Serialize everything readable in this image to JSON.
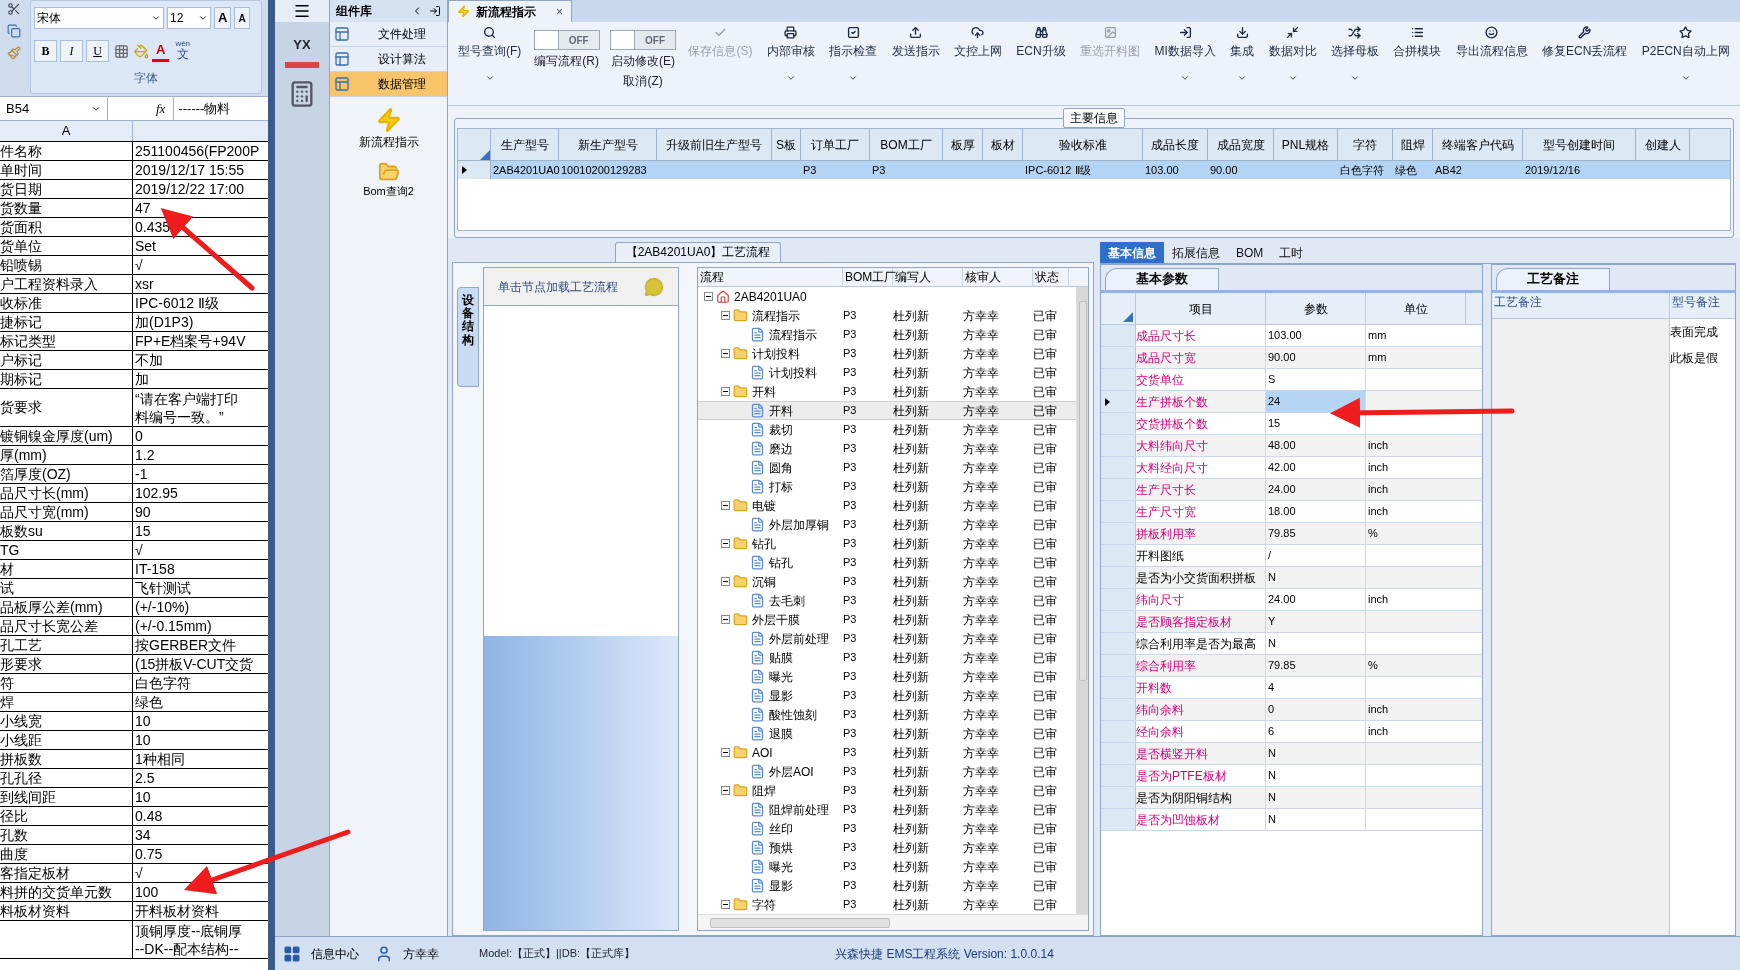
{
  "excel": {
    "font": "宋体",
    "size": "12",
    "grow": "A",
    "shrink": "A",
    "format_buttons": [
      "B",
      "I",
      "U"
    ],
    "font_color": "A",
    "phonetic_top": "wén",
    "phonetic": "文",
    "group_label": "字体",
    "name_box": "B54",
    "fx": "fx",
    "formula": "------物料",
    "column": "A",
    "rows": [
      {
        "label": "件名称",
        "value": "251100456(FP200P"
      },
      {
        "label": "单时间",
        "value": "2019/12/17 15:55"
      },
      {
        "label": "货日期",
        "value": "2019/12/22 17:00"
      },
      {
        "label": "货数量",
        "value": "47"
      },
      {
        "label": "货面积",
        "value": "0.435"
      },
      {
        "label": "货单位",
        "value": "Set"
      },
      {
        "label": "铅喷锡",
        "value": "√"
      },
      {
        "label": "户工程资料录入",
        "value": "xsr"
      },
      {
        "label": "收标准",
        "value": "IPC-6012 Ⅱ级"
      },
      {
        "label": "捷标记",
        "value": "加(D1P3)"
      },
      {
        "label": "标记类型",
        "value": "FP+E档案号+94V"
      },
      {
        "label": "户标记",
        "value": "不加"
      },
      {
        "label": "期标记",
        "value": "加"
      },
      {
        "label": "货要求",
        "value": "“请在客户端打印",
        "value2": "料编号一致。”"
      },
      {
        "label": "镀铜镍金厚度(um)",
        "value": "0"
      },
      {
        "label": "厚(mm)",
        "value": "1.2"
      },
      {
        "label": "箔厚度(OZ)",
        "value": "-1"
      },
      {
        "label": "品尺寸长(mm)",
        "value": "102.95"
      },
      {
        "label": "品尺寸宽(mm)",
        "value": "90"
      },
      {
        "label": "板数su",
        "value": "15"
      },
      {
        "label": "TG",
        "value": "√"
      },
      {
        "label": "材",
        "value": "IT-158"
      },
      {
        "label": "试",
        "value": "飞针测试"
      },
      {
        "label": "品板厚公差(mm)",
        "value": "(+/-10%)"
      },
      {
        "label": "品尺寸长宽公差",
        "value": "(+/-0.15mm)"
      },
      {
        "label": "孔工艺",
        "value": "按GERBER文件"
      },
      {
        "label": "形要求",
        "value": "(15拼板V-CUT交货"
      },
      {
        "label": "符",
        "value": "白色字符"
      },
      {
        "label": "焊",
        "value": "绿色"
      },
      {
        "label": "小线宽",
        "value": "10"
      },
      {
        "label": "小线距",
        "value": "10"
      },
      {
        "label": "拼板数",
        "value": "1种相同"
      },
      {
        "label": "孔孔径",
        "value": "2.5"
      },
      {
        "label": "到线间距",
        "value": "10"
      },
      {
        "label": "径比",
        "value": "0.48"
      },
      {
        "label": "孔数",
        "value": "34"
      },
      {
        "label": "曲度",
        "value": "0.75"
      },
      {
        "label": "客指定板材",
        "value": "√"
      },
      {
        "label": "料拼的交货单元数",
        "value": "100"
      },
      {
        "label": "料板材资料",
        "value": "开料板材资料"
      },
      {
        "value": "顶铜厚度--底铜厚",
        "value2": "--DK--配本结构--"
      }
    ]
  },
  "nav": {
    "logo": "YX"
  },
  "components": {
    "title": "组件库",
    "items": [
      {
        "label": "文件处理",
        "selected": false
      },
      {
        "label": "设计算法",
        "selected": false
      },
      {
        "label": "数据管理",
        "selected": true
      }
    ],
    "shortcuts": [
      "新流程指示",
      "Bom查询2"
    ]
  },
  "tab": {
    "label": "新流程指示",
    "close": "×"
  },
  "toolbar": [
    {
      "kind": "button",
      "label": "型号查询(F)",
      "dropdown": true,
      "disabled": false
    },
    {
      "kind": "toggle",
      "label": "编写流程(R)",
      "state": "OFF",
      "on": false
    },
    {
      "kind": "toggle",
      "label": "启动修改(E)",
      "label2": "取消(Z)",
      "state": "OFF",
      "on": false
    },
    {
      "kind": "button",
      "label": "保存信息(S)",
      "dropdown": false,
      "disabled": true
    },
    {
      "kind": "button",
      "label": "内部审核",
      "dropdown": true,
      "disabled": false
    },
    {
      "kind": "button",
      "label": "指示检查",
      "dropdown": true,
      "disabled": false
    },
    {
      "kind": "button",
      "label": "发送指示",
      "dropdown": false,
      "disabled": false
    },
    {
      "kind": "button",
      "label": "文控上网",
      "dropdown": false,
      "disabled": false
    },
    {
      "kind": "button",
      "label": "ECN升级",
      "dropdown": false,
      "disabled": false
    },
    {
      "kind": "button",
      "label": "重选开料图",
      "dropdown": false,
      "disabled": true
    },
    {
      "kind": "button",
      "label": "MI数据导入",
      "dropdown": true,
      "disabled": false
    },
    {
      "kind": "button",
      "label": "集成",
      "dropdown": true,
      "disabled": false
    },
    {
      "kind": "button",
      "label": "数据对比",
      "dropdown": true,
      "disabled": false
    },
    {
      "kind": "button",
      "label": "选择母板",
      "dropdown": true,
      "disabled": false
    },
    {
      "kind": "button",
      "label": "合拼模块",
      "dropdown": false,
      "disabled": false
    },
    {
      "kind": "button",
      "label": "导出流程信息",
      "dropdown": false,
      "disabled": false
    },
    {
      "kind": "button",
      "label": "修复ECN丢流程",
      "dropdown": false,
      "disabled": false
    },
    {
      "kind": "button",
      "label": "P2ECN自动上网",
      "dropdown": true,
      "disabled": false
    }
  ],
  "main_info": {
    "title": "主要信息",
    "columns": [
      "生产型号",
      "新生产型号",
      "升级前旧生产型号",
      "S板",
      "订单工厂",
      "BOM工厂",
      "板厚",
      "板材",
      "验收标准",
      "成品长度",
      "成品宽度",
      "PNL规格",
      "字符",
      "阻焊",
      "终端客户代码",
      "型号创建时间",
      "创建人"
    ],
    "rows": [
      {
        "selected": true,
        "cells": [
          "2AB4201UA0",
          "10010200129283",
          null,
          null,
          "P3",
          "P3",
          null,
          null,
          "IPC-6012 Ⅱ级",
          "103.00",
          "90.00",
          null,
          "白色字符",
          "绿色",
          "AB42",
          "2019/12/16",
          null
        ]
      }
    ]
  },
  "process": {
    "title": "【2AB4201UA0】工艺流程",
    "side_tab": "设备结构",
    "hint": "单击节点加载工艺流程",
    "columns": [
      "流程",
      "BOM工厂",
      "编写人",
      "核审人",
      "状态"
    ],
    "tree": [
      {
        "kind": "root",
        "name": "2AB4201UA0",
        "expanded": true,
        "selected": false,
        "children": [
          {
            "kind": "folder",
            "name": "流程指示",
            "bom": "P3",
            "writer": "杜列新",
            "reviewer": "方幸幸",
            "status": "已审",
            "expanded": true,
            "selected": false,
            "children": [
              {
                "kind": "step",
                "name": "流程指示",
                "bom": "P3",
                "writer": "杜列新",
                "reviewer": "方幸幸",
                "status": "已审",
                "selected": false
              }
            ]
          },
          {
            "kind": "folder",
            "name": "计划投料",
            "bom": "P3",
            "writer": "杜列新",
            "reviewer": "方幸幸",
            "status": "已审",
            "expanded": true,
            "selected": false,
            "children": [
              {
                "kind": "step",
                "name": "计划投料",
                "bom": "P3",
                "writer": "杜列新",
                "reviewer": "方幸幸",
                "status": "已审",
                "selected": false
              }
            ]
          },
          {
            "kind": "folder",
            "name": "开料",
            "bom": "P3",
            "writer": "杜列新",
            "reviewer": "方幸幸",
            "status": "已审",
            "expanded": true,
            "selected": false,
            "children": [
              {
                "kind": "step",
                "name": "开料",
                "bom": "P3",
                "writer": "杜列新",
                "reviewer": "方幸幸",
                "status": "已审",
                "selected": true
              },
              {
                "kind": "step",
                "name": "裁切",
                "bom": "P3",
                "writer": "杜列新",
                "reviewer": "方幸幸",
                "status": "已审",
                "selected": false
              },
              {
                "kind": "step",
                "name": "磨边",
                "bom": "P3",
                "writer": "杜列新",
                "reviewer": "方幸幸",
                "status": "已审",
                "selected": false
              },
              {
                "kind": "step",
                "name": "圆角",
                "bom": "P3",
                "writer": "杜列新",
                "reviewer": "方幸幸",
                "status": "已审",
                "selected": false
              },
              {
                "kind": "step",
                "name": "打标",
                "bom": "P3",
                "writer": "杜列新",
                "reviewer": "方幸幸",
                "status": "已审",
                "selected": false
              }
            ]
          },
          {
            "kind": "folder",
            "name": "电镀",
            "bom": "P3",
            "writer": "杜列新",
            "reviewer": "方幸幸",
            "status": "已审",
            "expanded": true,
            "selected": false,
            "children": [
              {
                "kind": "step",
                "name": "外层加厚铜",
                "bom": "P3",
                "writer": "杜列新",
                "reviewer": "方幸幸",
                "status": "已审",
                "selected": false
              }
            ]
          },
          {
            "kind": "folder",
            "name": "钻孔",
            "bom": "P3",
            "writer": "杜列新",
            "reviewer": "方幸幸",
            "status": "已审",
            "expanded": true,
            "selected": false,
            "children": [
              {
                "kind": "step",
                "name": "钻孔",
                "bom": "P3",
                "writer": "杜列新",
                "reviewer": "方幸幸",
                "status": "已审",
                "selected": false
              }
            ]
          },
          {
            "kind": "folder",
            "name": "沉铜",
            "bom": "P3",
            "writer": "杜列新",
            "reviewer": "方幸幸",
            "status": "已审",
            "expanded": true,
            "selected": false,
            "children": [
              {
                "kind": "step",
                "name": "去毛刺",
                "bom": "P3",
                "writer": "杜列新",
                "reviewer": "方幸幸",
                "status": "已审",
                "selected": false
              }
            ]
          },
          {
            "kind": "folder",
            "name": "外层干膜",
            "bom": "P3",
            "writer": "杜列新",
            "reviewer": "方幸幸",
            "status": "已审",
            "expanded": true,
            "selected": false,
            "children": [
              {
                "kind": "step",
                "name": "外层前处理",
                "bom": "P3",
                "writer": "杜列新",
                "reviewer": "方幸幸",
                "status": "已审",
                "selected": false
              },
              {
                "kind": "step",
                "name": "贴膜",
                "bom": "P3",
                "writer": "杜列新",
                "reviewer": "方幸幸",
                "status": "已审",
                "selected": false
              },
              {
                "kind": "step",
                "name": "曝光",
                "bom": "P3",
                "writer": "杜列新",
                "reviewer": "方幸幸",
                "status": "已审",
                "selected": false
              },
              {
                "kind": "step",
                "name": "显影",
                "bom": "P3",
                "writer": "杜列新",
                "reviewer": "方幸幸",
                "status": "已审",
                "selected": false
              },
              {
                "kind": "step",
                "name": "酸性蚀刻",
                "bom": "P3",
                "writer": "杜列新",
                "reviewer": "方幸幸",
                "status": "已审",
                "selected": false
              },
              {
                "kind": "step",
                "name": "退膜",
                "bom": "P3",
                "writer": "杜列新",
                "reviewer": "方幸幸",
                "status": "已审",
                "selected": false
              }
            ]
          },
          {
            "kind": "folder",
            "name": "AOI",
            "bom": "P3",
            "writer": "杜列新",
            "reviewer": "方幸幸",
            "status": "已审",
            "expanded": true,
            "selected": false,
            "children": [
              {
                "kind": "step",
                "name": "外层AOI",
                "bom": "P3",
                "writer": "杜列新",
                "reviewer": "方幸幸",
                "status": "已审",
                "selected": false
              }
            ]
          },
          {
            "kind": "folder",
            "name": "阻焊",
            "bom": "P3",
            "writer": "杜列新",
            "reviewer": "方幸幸",
            "status": "已审",
            "expanded": true,
            "selected": false,
            "children": [
              {
                "kind": "step",
                "name": "阻焊前处理",
                "bom": "P3",
                "writer": "杜列新",
                "reviewer": "方幸幸",
                "status": "已审",
                "selected": false
              },
              {
                "kind": "step",
                "name": "丝印",
                "bom": "P3",
                "writer": "杜列新",
                "reviewer": "方幸幸",
                "status": "已审",
                "selected": false
              },
              {
                "kind": "step",
                "name": "预烘",
                "bom": "P3",
                "writer": "杜列新",
                "reviewer": "方幸幸",
                "status": "已审",
                "selected": false
              },
              {
                "kind": "step",
                "name": "曝光",
                "bom": "P3",
                "writer": "杜列新",
                "reviewer": "方幸幸",
                "status": "已审",
                "selected": false
              },
              {
                "kind": "step",
                "name": "显影",
                "bom": "P3",
                "writer": "杜列新",
                "reviewer": "方幸幸",
                "status": "已审",
                "selected": false
              }
            ]
          },
          {
            "kind": "folder",
            "name": "字符",
            "bom": "P3",
            "writer": "杜列新",
            "reviewer": "方幸幸",
            "status": "已审",
            "expanded": true,
            "selected": false
          }
        ]
      }
    ]
  },
  "detail_tabs": [
    {
      "label": "基本信息",
      "selected": true
    },
    {
      "label": "拓展信息",
      "selected": false
    },
    {
      "label": "BOM",
      "selected": false
    },
    {
      "label": "工时",
      "selected": false
    }
  ],
  "params": {
    "title": "基本参数",
    "columns": [
      "项目",
      "参数",
      "单位"
    ],
    "rows": [
      {
        "item": "成品尺寸长",
        "value": "103.00",
        "unit": "mm",
        "kind": "required",
        "selected": false
      },
      {
        "item": "成品尺寸宽",
        "value": "90.00",
        "unit": "mm",
        "kind": "required",
        "selected": false
      },
      {
        "item": "交货单位",
        "value": "S",
        "kind": "required",
        "selected": false
      },
      {
        "item": "生产拼板个数",
        "value": "24",
        "kind": "required",
        "selected": true
      },
      {
        "item": "交货拼板个数",
        "value": "15",
        "kind": "required",
        "selected": false
      },
      {
        "item": "大料纬向尺寸",
        "value": "48.00",
        "unit": "inch",
        "kind": "required",
        "selected": false
      },
      {
        "item": "大料经向尺寸",
        "value": "42.00",
        "unit": "inch",
        "kind": "required",
        "selected": false
      },
      {
        "item": "生产尺寸长",
        "value": "24.00",
        "unit": "inch",
        "kind": "required",
        "selected": false
      },
      {
        "item": "生产尺寸宽",
        "value": "18.00",
        "unit": "inch",
        "kind": "required",
        "selected": false
      },
      {
        "item": "拼板利用率",
        "value": "79.85",
        "unit": "%",
        "kind": "required",
        "selected": false
      },
      {
        "item": "开料图纸",
        "value": "/",
        "kind": "optional",
        "selected": false
      },
      {
        "item": "是否为小交货面积拼板",
        "value": "N",
        "kind": "optional",
        "selected": false
      },
      {
        "item": "纬向尺寸",
        "value": "24.00",
        "unit": "inch",
        "kind": "required",
        "selected": false
      },
      {
        "item": "是否顾客指定板材",
        "value": "Y",
        "kind": "required",
        "selected": false
      },
      {
        "item": "综合利用率是否为最高",
        "value": "N",
        "kind": "optional",
        "selected": false
      },
      {
        "item": "综合利用率",
        "value": "79.85",
        "unit": "%",
        "kind": "required",
        "selected": false
      },
      {
        "item": "开料数",
        "value": "4",
        "kind": "required",
        "selected": false
      },
      {
        "item": "纬向余料",
        "value": "0",
        "unit": "inch",
        "kind": "required",
        "selected": false
      },
      {
        "item": "经向余料",
        "value": "6",
        "unit": "inch",
        "kind": "required",
        "selected": false
      },
      {
        "item": "是否横竖开料",
        "value": "N",
        "kind": "required",
        "selected": false
      },
      {
        "item": "是否为PTFE板材",
        "value": "N",
        "kind": "required",
        "selected": false
      },
      {
        "item": "是否为阴阳铜结构",
        "value": "N",
        "kind": "optional",
        "selected": false
      },
      {
        "item": "是否为凹蚀板材",
        "value": "N",
        "kind": "required",
        "selected": false
      }
    ]
  },
  "notes": {
    "title": "工艺备注",
    "columns": [
      "工艺备注",
      "型号备注"
    ],
    "lines": [
      "表面完成",
      "此板是假"
    ]
  },
  "status_bar": {
    "info": "信息中心",
    "user": "方幸幸",
    "model": "Model:【正式】||DB:【正式库】",
    "product": "兴森快捷 EMS工程系统 Version: 1.0.0.14"
  }
}
